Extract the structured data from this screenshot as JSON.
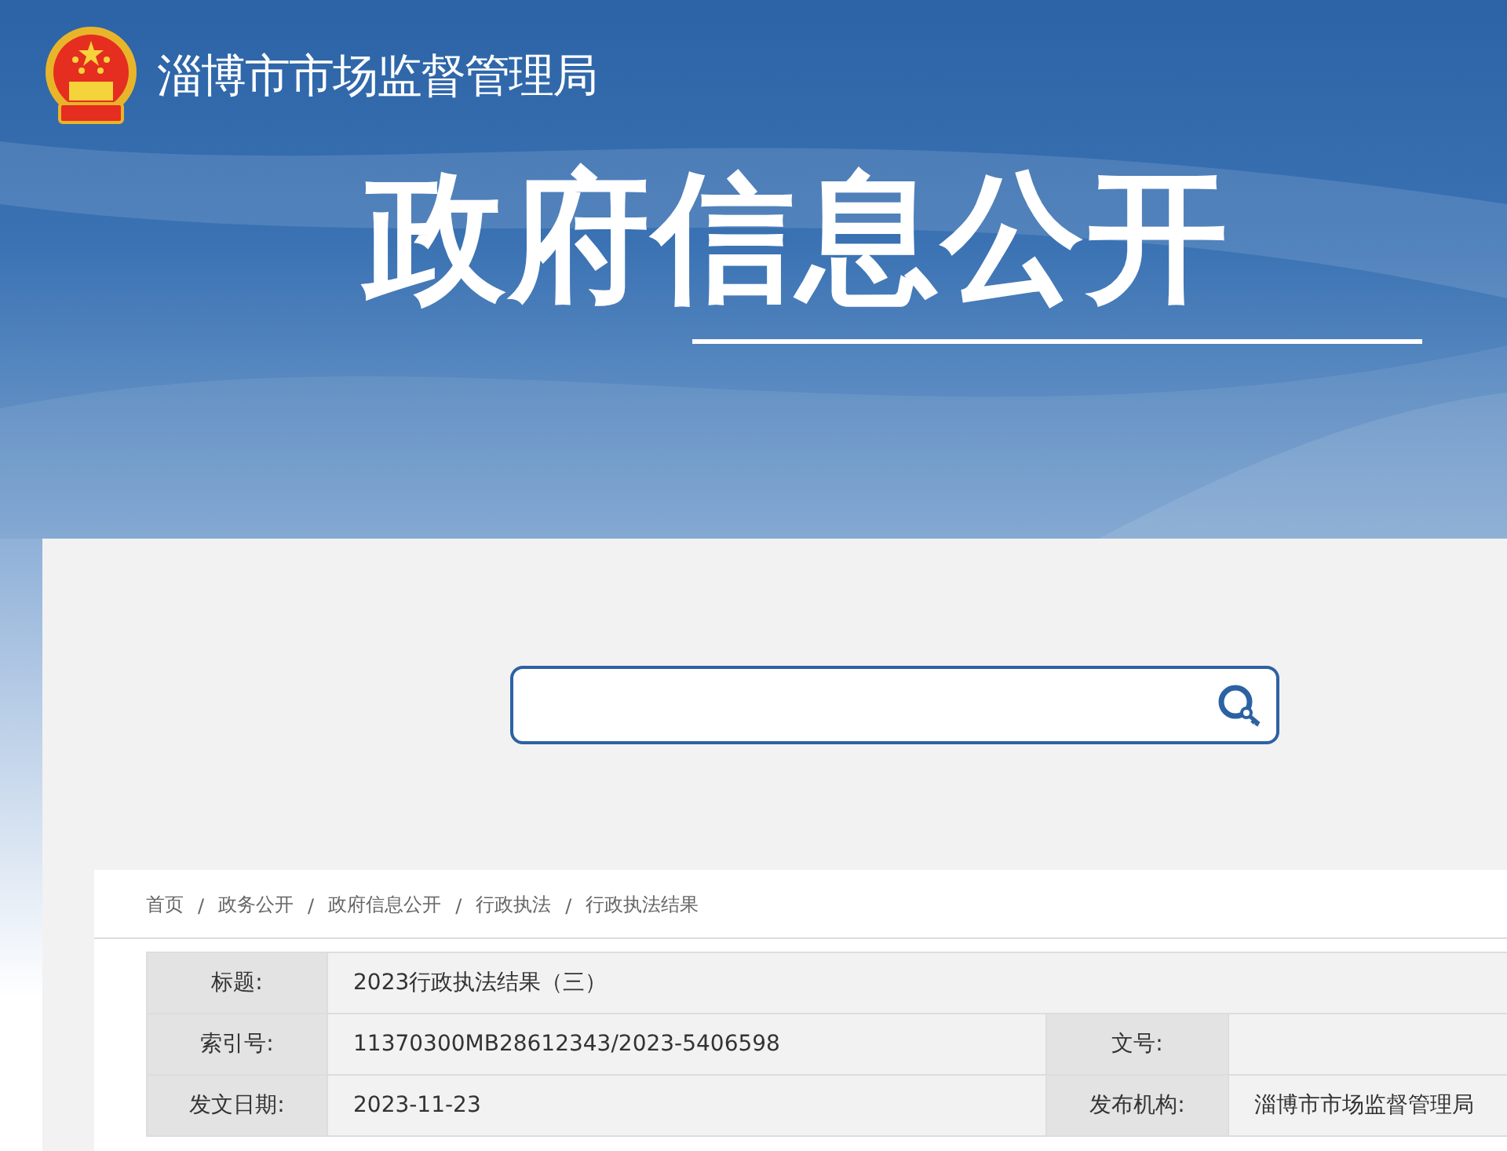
{
  "header": {
    "site_title": "淄博市市场监督管理局",
    "banner_title": "政府信息公开"
  },
  "breadcrumb": [
    "首页",
    "政务公开",
    "政府信息公开",
    "行政执法",
    "行政执法结果"
  ],
  "breadcrumb_separator": "/",
  "info_table": {
    "rows": [
      {
        "cells": [
          {
            "label": "标题:",
            "value": "2023行政执法结果（三）"
          }
        ]
      },
      {
        "cells": [
          {
            "label": "索引号:",
            "value": "11370300MB28612343/2023-5406598"
          },
          {
            "label": "文号:"
          }
        ]
      },
      {
        "cells": [
          {
            "label": "发文日期:",
            "value": "2023-11-23"
          },
          {
            "label": "发布机构:",
            "value": "淄博市市场监督管理局"
          }
        ]
      }
    ]
  }
}
